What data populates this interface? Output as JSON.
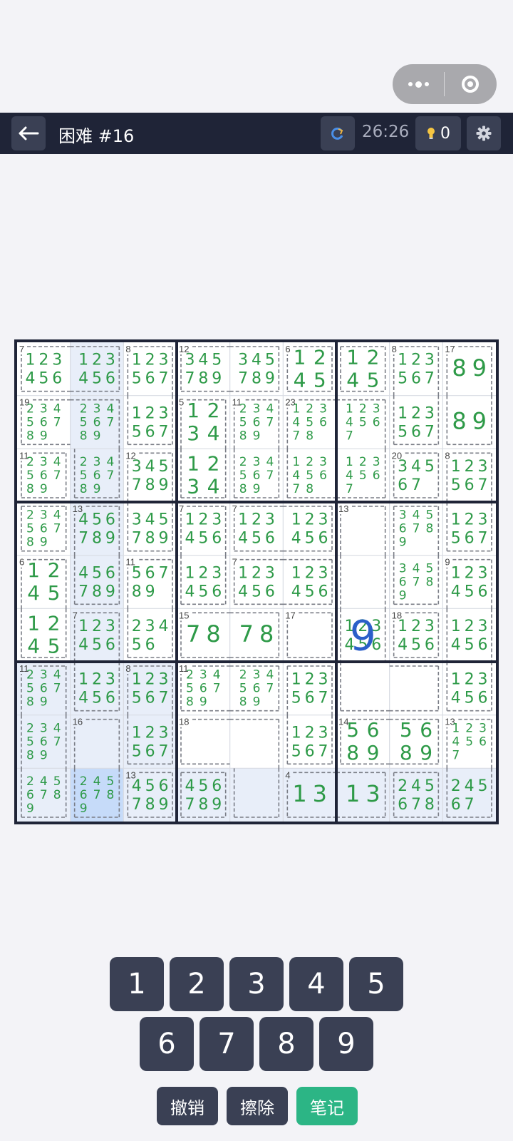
{
  "header": {
    "title": "困难 #16",
    "timer": "26:26",
    "hint_count": "0"
  },
  "board": {
    "size": 9,
    "selected": [
      8,
      1
    ],
    "highlighted": [
      [
        0,
        1
      ],
      [
        1,
        1
      ],
      [
        2,
        1
      ],
      [
        3,
        1
      ],
      [
        4,
        1
      ],
      [
        5,
        1
      ],
      [
        6,
        0
      ],
      [
        6,
        1
      ],
      [
        6,
        2
      ],
      [
        7,
        0
      ],
      [
        7,
        1
      ],
      [
        7,
        2
      ],
      [
        8,
        0
      ],
      [
        8,
        2
      ],
      [
        8,
        3
      ],
      [
        8,
        4
      ],
      [
        8,
        5
      ],
      [
        8,
        6
      ],
      [
        8,
        7
      ],
      [
        8,
        8
      ]
    ],
    "values": [
      [
        5,
        6,
        "9"
      ]
    ],
    "cages": [
      {
        "sum": "7",
        "cells": [
          [
            0,
            0
          ],
          [
            0,
            1
          ]
        ]
      },
      {
        "sum": "8",
        "cells": [
          [
            0,
            2
          ],
          [
            1,
            2
          ]
        ]
      },
      {
        "sum": "12",
        "cells": [
          [
            0,
            3
          ],
          [
            0,
            4
          ]
        ]
      },
      {
        "sum": "6",
        "cells": [
          [
            0,
            5
          ]
        ]
      },
      {
        "sum": "",
        "cells": [
          [
            0,
            6
          ]
        ]
      },
      {
        "sum": "8",
        "cells": [
          [
            0,
            7
          ],
          [
            1,
            7
          ]
        ]
      },
      {
        "sum": "17",
        "cells": [
          [
            0,
            8
          ],
          [
            1,
            8
          ]
        ]
      },
      {
        "sum": "19",
        "cells": [
          [
            1,
            0
          ],
          [
            1,
            1
          ],
          [
            2,
            1
          ]
        ]
      },
      {
        "sum": "5",
        "cells": [
          [
            1,
            3
          ],
          [
            2,
            3
          ]
        ]
      },
      {
        "sum": "11",
        "cells": [
          [
            1,
            4
          ],
          [
            2,
            4
          ]
        ]
      },
      {
        "sum": "23",
        "cells": [
          [
            1,
            5
          ],
          [
            1,
            6
          ],
          [
            2,
            5
          ],
          [
            2,
            6
          ]
        ]
      },
      {
        "sum": "11",
        "cells": [
          [
            2,
            0
          ]
        ]
      },
      {
        "sum": "12",
        "cells": [
          [
            2,
            2
          ],
          [
            3,
            2
          ]
        ]
      },
      {
        "sum": "20",
        "cells": [
          [
            2,
            7
          ]
        ]
      },
      {
        "sum": "8",
        "cells": [
          [
            2,
            8
          ],
          [
            3,
            8
          ]
        ]
      },
      {
        "sum": "",
        "cells": [
          [
            3,
            0
          ]
        ]
      },
      {
        "sum": "13",
        "cells": [
          [
            3,
            1
          ],
          [
            4,
            1
          ]
        ]
      },
      {
        "sum": "7",
        "cells": [
          [
            3,
            3
          ],
          [
            4,
            3
          ]
        ]
      },
      {
        "sum": "7",
        "cells": [
          [
            3,
            4
          ],
          [
            3,
            5
          ]
        ]
      },
      {
        "sum": "13",
        "cells": [
          [
            3,
            6
          ],
          [
            4,
            6
          ],
          [
            5,
            6
          ],
          [
            6,
            6
          ],
          [
            6,
            7
          ]
        ]
      },
      {
        "sum": "",
        "cells": [
          [
            3,
            7
          ],
          [
            4,
            7
          ]
        ]
      },
      {
        "sum": "6",
        "cells": [
          [
            4,
            0
          ],
          [
            5,
            0
          ]
        ]
      },
      {
        "sum": "11",
        "cells": [
          [
            4,
            2
          ],
          [
            5,
            2
          ]
        ]
      },
      {
        "sum": "7",
        "cells": [
          [
            4,
            4
          ],
          [
            4,
            5
          ]
        ]
      },
      {
        "sum": "9",
        "cells": [
          [
            4,
            8
          ],
          [
            5,
            8
          ],
          [
            6,
            8
          ]
        ]
      },
      {
        "sum": "7",
        "cells": [
          [
            5,
            1
          ],
          [
            6,
            1
          ]
        ]
      },
      {
        "sum": "15",
        "cells": [
          [
            5,
            3
          ],
          [
            5,
            4
          ]
        ]
      },
      {
        "sum": "17",
        "cells": [
          [
            5,
            5
          ]
        ]
      },
      {
        "sum": "18",
        "cells": [
          [
            5,
            7
          ]
        ]
      },
      {
        "sum": "11",
        "cells": [
          [
            6,
            0
          ],
          [
            7,
            0
          ],
          [
            8,
            0
          ]
        ]
      },
      {
        "sum": "8",
        "cells": [
          [
            6,
            2
          ],
          [
            7,
            2
          ]
        ]
      },
      {
        "sum": "11",
        "cells": [
          [
            6,
            3
          ],
          [
            6,
            4
          ]
        ]
      },
      {
        "sum": "",
        "cells": [
          [
            6,
            5
          ],
          [
            7,
            5
          ]
        ]
      },
      {
        "sum": "16",
        "cells": [
          [
            7,
            1
          ],
          [
            8,
            1
          ]
        ]
      },
      {
        "sum": "18",
        "cells": [
          [
            7,
            3
          ],
          [
            7,
            4
          ],
          [
            8,
            4
          ]
        ]
      },
      {
        "sum": "14",
        "cells": [
          [
            7,
            6
          ],
          [
            7,
            7
          ]
        ]
      },
      {
        "sum": "13",
        "cells": [
          [
            7,
            8
          ],
          [
            8,
            8
          ]
        ]
      },
      {
        "sum": "13",
        "cells": [
          [
            8,
            2
          ]
        ]
      },
      {
        "sum": "",
        "cells": [
          [
            8,
            3
          ]
        ]
      },
      {
        "sum": "4",
        "cells": [
          [
            8,
            5
          ],
          [
            8,
            6
          ]
        ]
      },
      {
        "sum": "",
        "cells": [
          [
            8,
            7
          ]
        ]
      }
    ],
    "notes": [
      [
        [
          "123456"
        ],
        [
          "123456"
        ],
        [
          "123567"
        ],
        [
          "345789"
        ],
        [
          "34578 9"
        ],
        [
          "1245"
        ],
        [
          "1245"
        ],
        [
          "123567"
        ],
        [
          "89"
        ]
      ],
      [
        [
          "23456789"
        ],
        [
          "2345678 9"
        ],
        [
          "123567"
        ],
        [
          "1234"
        ],
        [
          "23456789"
        ],
        [
          "12345678"
        ],
        [
          "1234567"
        ],
        [
          "123567"
        ],
        [
          "89"
        ]
      ],
      [
        [
          "23456789"
        ],
        [
          "23456789"
        ],
        [
          "345789"
        ],
        [
          "1234"
        ],
        [
          "23456789"
        ],
        [
          "12345678"
        ],
        [
          "1234567"
        ],
        [
          "34567"
        ],
        [
          "123567"
        ]
      ],
      [
        [
          "23456789"
        ],
        [
          "456789"
        ],
        [
          "345789"
        ],
        [
          "123456"
        ],
        [
          "123456"
        ],
        [
          "123456"
        ],
        [
          ""
        ],
        [
          "3456789"
        ],
        [
          "123567"
        ]
      ],
      [
        [
          "1245"
        ],
        [
          "456789"
        ],
        [
          "56789"
        ],
        [
          "123456"
        ],
        [
          "123456"
        ],
        [
          "123456"
        ],
        [
          ""
        ],
        [
          "3456789"
        ],
        [
          "123456"
        ]
      ],
      [
        [
          "1245"
        ],
        [
          "123456"
        ],
        [
          "23456"
        ],
        [
          "78"
        ],
        [
          "78"
        ],
        [
          ""
        ],
        [
          "123456"
        ],
        [
          "123456"
        ],
        [
          "123456"
        ]
      ],
      [
        [
          "23456789"
        ],
        [
          "123456"
        ],
        [
          "123567"
        ],
        [
          "23456789"
        ],
        [
          "23456789"
        ],
        [
          "123567"
        ],
        [
          ""
        ],
        [
          ""
        ],
        [
          "123456"
        ]
      ],
      [
        [
          "23456789"
        ],
        [
          ""
        ],
        [
          "123567"
        ],
        [
          ""
        ],
        [
          ""
        ],
        [
          "123567"
        ],
        [
          "5689"
        ],
        [
          "5689"
        ],
        [
          "1234567"
        ]
      ],
      [
        [
          "2456789"
        ],
        [
          "2456789"
        ],
        [
          "456789"
        ],
        [
          "456789"
        ],
        [
          ""
        ],
        [
          "13"
        ],
        [
          "13"
        ],
        [
          "245678"
        ],
        [
          "24567"
        ]
      ]
    ]
  },
  "keypad": {
    "digits": [
      "1",
      "2",
      "3",
      "4",
      "5",
      "6",
      "7",
      "8",
      "9"
    ],
    "undo_label": "撤销",
    "erase_label": "擦除",
    "notes_label": "笔记"
  },
  "colors": {
    "note": "#2e9a48",
    "value": "#2b5fc9",
    "notes_button": "#2cb585",
    "header_bg": "#1f2437",
    "key_bg": "#3a4054",
    "highlight": "#e8eef9",
    "selected": "#c6dbf9"
  }
}
